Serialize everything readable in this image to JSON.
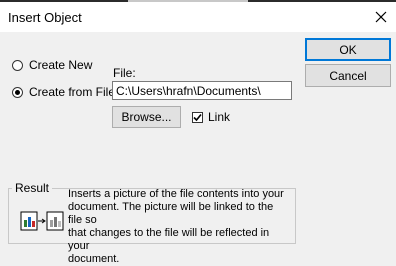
{
  "window": {
    "title": "Insert Object"
  },
  "buttons": {
    "ok": "OK",
    "cancel": "Cancel",
    "browse": "Browse..."
  },
  "options": {
    "create_new": "Create New",
    "create_from_file": "Create from File",
    "selected": "create_from_file"
  },
  "file": {
    "label": "File:",
    "value": "C:\\Users\\hrafn\\Documents\\"
  },
  "link": {
    "label": "Link",
    "checked": true
  },
  "result": {
    "legend": "Result",
    "line1": "Inserts a picture of the file contents into your",
    "line2": "document.  The picture will be linked to the file so",
    "line3": "that changes to the file will be reflected in your",
    "line4": "document."
  },
  "icons": {
    "close": "close-icon",
    "result": "link-picture-icon"
  },
  "colors": {
    "accent": "#0078d7",
    "background": "#f0f0f0"
  }
}
